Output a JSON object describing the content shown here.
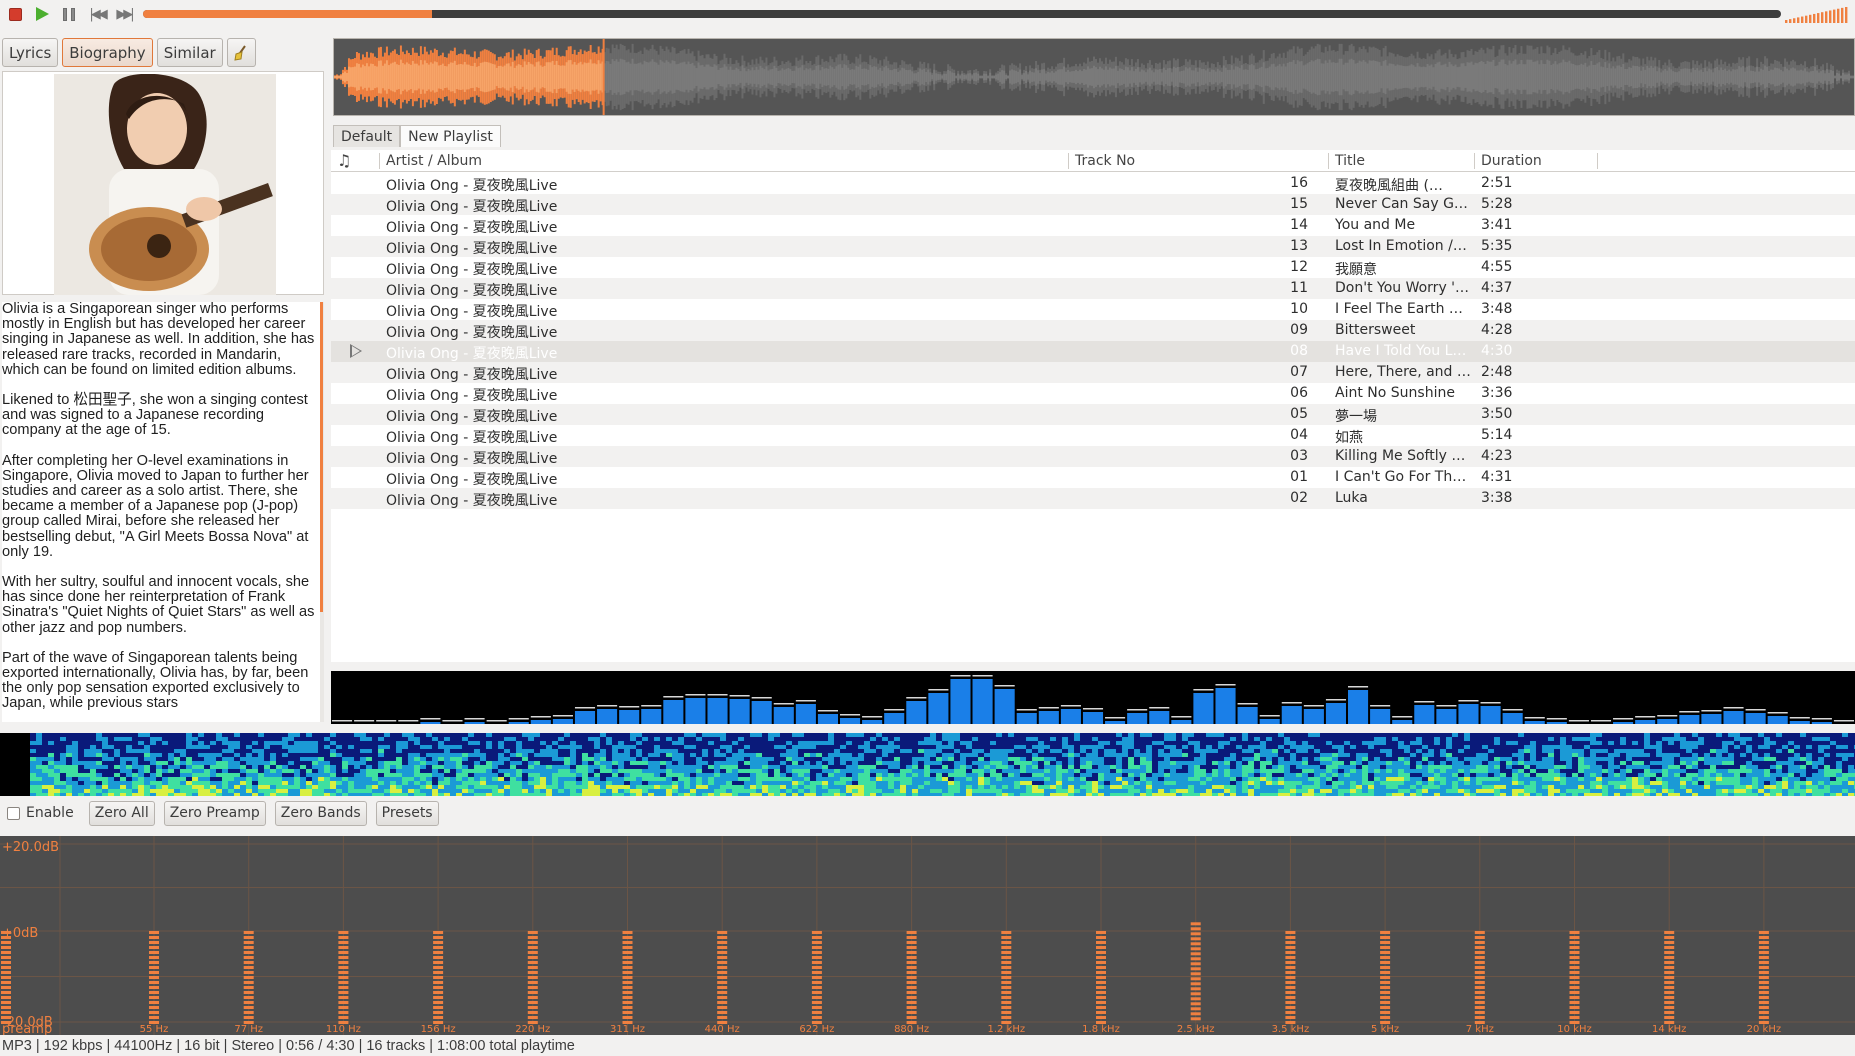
{
  "toolbar": {
    "buttons": [
      {
        "name": "stop",
        "icon": "stop-icon"
      },
      {
        "name": "play",
        "icon": "play-icon"
      },
      {
        "name": "pause",
        "icon": "pause-icon"
      },
      {
        "name": "previous",
        "icon": "previous-icon"
      },
      {
        "name": "next",
        "icon": "next-icon"
      }
    ],
    "seek_progress": 0.1767,
    "volume_level": 1.0,
    "colors": {
      "accent": "#f08040",
      "stop": "#d43c2c",
      "play": "#4caf2f"
    }
  },
  "left_panel": {
    "tabs": [
      "Lyrics",
      "Biography",
      "Similar"
    ],
    "active_tab": "Biography",
    "clear_icon": "broom-icon",
    "photo": "artist-photo",
    "biography": [
      "Olivia is a Singaporean singer who performs mostly in English but has developed her career singing in Japanese as well. In addition, she has released rare tracks, recorded in Mandarin, which can be found on limited edition albums.",
      "Likened to 松田聖子, she won a singing contest and was signed to a Japanese recording company at the age of 15.",
      "After completing her O-level examinations in Singapore, Olivia moved to Japan to further her studies and career as a solo artist. There, she became a member of a Japanese pop (J-pop) group called Mirai, before she released her bestselling debut, \"A Girl Meets Bossa Nova\" at only 19.",
      "With her sultry, soulful and innocent vocals, she has since done her reinterpretation of Frank Sinatra's \"Quiet Nights of Quiet Stars\" as well as other jazz and pop numbers.",
      "Part of the wave of Singaporean talents being exported internationally, Olivia has, by far, been the only pop sensation exported exclusively to Japan, while previous stars"
    ]
  },
  "waveform": {
    "played_fraction": 0.1767,
    "played_color": "#f08040",
    "remaining_color": "#5c5c5c"
  },
  "playlist_tabs": [
    "Default",
    "New Playlist"
  ],
  "active_playlist": "New Playlist",
  "columns": {
    "icon": "music-note-icon",
    "artist_album": "Artist / Album",
    "track_no": "Track No",
    "title": "Title",
    "duration": "Duration"
  },
  "tracks": [
    {
      "artist_album": "Olivia Ong - 夏夜晚風Live",
      "track_no": "16",
      "title": "夏夜晚風組曲 (…",
      "duration": "2:51"
    },
    {
      "artist_album": "Olivia Ong - 夏夜晚風Live",
      "track_no": "15",
      "title": "Never Can Say Go…",
      "duration": "5:28"
    },
    {
      "artist_album": "Olivia Ong - 夏夜晚風Live",
      "track_no": "14",
      "title": "You and Me",
      "duration": "3:41"
    },
    {
      "artist_album": "Olivia Ong - 夏夜晚風Live",
      "track_no": "13",
      "title": "Lost In Emotion /…",
      "duration": "5:35"
    },
    {
      "artist_album": "Olivia Ong - 夏夜晚風Live",
      "track_no": "12",
      "title": "我願意",
      "duration": "4:55"
    },
    {
      "artist_album": "Olivia Ong - 夏夜晚風Live",
      "track_no": "11",
      "title": "Don't You Worry '…",
      "duration": "4:37"
    },
    {
      "artist_album": "Olivia Ong - 夏夜晚風Live",
      "track_no": "10",
      "title": "I Feel The Earth M…",
      "duration": "3:48"
    },
    {
      "artist_album": "Olivia Ong - 夏夜晚風Live",
      "track_no": "09",
      "title": "Bittersweet",
      "duration": "4:28"
    },
    {
      "artist_album": "Olivia Ong - 夏夜晚風Live",
      "track_no": "08",
      "title": "Have I Told You L…",
      "duration": "4:30",
      "playing": true
    },
    {
      "artist_album": "Olivia Ong - 夏夜晚風Live",
      "track_no": "07",
      "title": "Here, There, and …",
      "duration": "2:48"
    },
    {
      "artist_album": "Olivia Ong - 夏夜晚風Live",
      "track_no": "06",
      "title": "Aint No Sunshine",
      "duration": "3:36"
    },
    {
      "artist_album": "Olivia Ong - 夏夜晚風Live",
      "track_no": "05",
      "title": "夢一場",
      "duration": "3:50"
    },
    {
      "artist_album": "Olivia Ong - 夏夜晚風Live",
      "track_no": "04",
      "title": "如燕",
      "duration": "5:14"
    },
    {
      "artist_album": "Olivia Ong - 夏夜晚風Live",
      "track_no": "03",
      "title": "Killing Me Softly …",
      "duration": "4:23"
    },
    {
      "artist_album": "Olivia Ong - 夏夜晚風Live",
      "track_no": "01",
      "title": "I Can't Go For Tha…",
      "duration": "4:31"
    },
    {
      "artist_album": "Olivia Ong - 夏夜晚風Live",
      "track_no": "02",
      "title": "Luka",
      "duration": "3:38"
    }
  ],
  "analyzer": {
    "bar_color": "#1a7fe8",
    "levels": [
      0,
      0,
      0,
      0,
      0.04,
      0,
      0.04,
      0,
      0.04,
      0.08,
      0.1,
      0.26,
      0.3,
      0.28,
      0.3,
      0.48,
      0.52,
      0.52,
      0.5,
      0.46,
      0.34,
      0.4,
      0.2,
      0.12,
      0.08,
      0.22,
      0.46,
      0.62,
      0.9,
      0.9,
      0.7,
      0.22,
      0.26,
      0.3,
      0.24,
      0.06,
      0.22,
      0.26,
      0.08,
      0.62,
      0.72,
      0.34,
      0.1,
      0.36,
      0.3,
      0.42,
      0.68,
      0.3,
      0.08,
      0.38,
      0.3,
      0.4,
      0.36,
      0.22,
      0.06,
      0.04,
      0,
      0,
      0.04,
      0.08,
      0.1,
      0.18,
      0.2,
      0.26,
      0.22,
      0.16,
      0.06,
      0.04,
      0
    ]
  },
  "spectrogram": {
    "palette": [
      "#0a1a7a",
      "#1b9ad6",
      "#3fe0a0",
      "#d8ef40"
    ]
  },
  "equalizer": {
    "enable_label": "Enable",
    "enabled": false,
    "buttons": [
      "Zero All",
      "Zero Preamp",
      "Zero Bands",
      "Presets"
    ],
    "db_labels": [
      "+20.0dB",
      "+0dB",
      "-20.0dB"
    ],
    "preamp_label": "preamp",
    "bands": [
      "55 Hz",
      "77 Hz",
      "110 Hz",
      "156 Hz",
      "220 Hz",
      "311 Hz",
      "440 Hz",
      "622 Hz",
      "880 Hz",
      "1.2 kHz",
      "1.8 kHz",
      "2.5 kHz",
      "3.5 kHz",
      "5 kHz",
      "7 kHz",
      "10 kHz",
      "14 kHz",
      "20 kHz"
    ],
    "preamp_db": 0,
    "band_db": [
      0,
      0,
      0,
      0,
      0,
      0,
      0,
      0,
      0,
      0,
      0,
      2,
      0,
      0,
      0,
      0,
      0,
      0
    ],
    "color": "#f08040",
    "background": "#4d4d4d"
  },
  "status": "MP3 | 192 kbps | 44100Hz | 16 bit | Stereo | 0:56 / 4:30 | 16 tracks | 1:08:00 total playtime"
}
